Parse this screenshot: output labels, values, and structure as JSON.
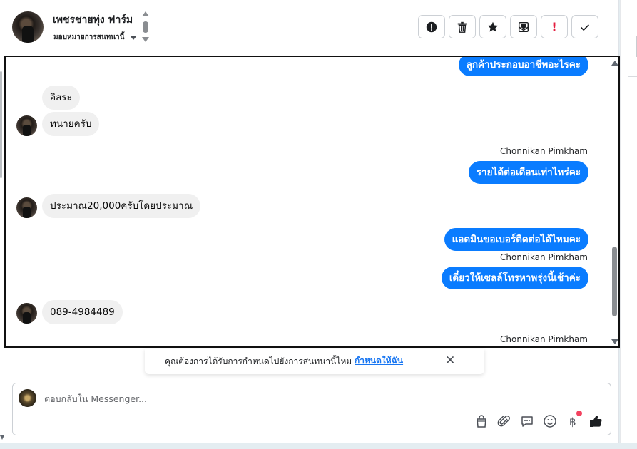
{
  "header": {
    "contact_name": "เพชรชายทุ่ง ฟาร์ม",
    "assign_label": "มอบหมายการสนทนานี้",
    "actions": [
      {
        "name": "mark-spam-button",
        "icon": "exclamation-circle-icon"
      },
      {
        "name": "delete-button",
        "icon": "trash-icon"
      },
      {
        "name": "star-button",
        "icon": "star-icon"
      },
      {
        "name": "mark-unread-button",
        "icon": "envelope-icon"
      },
      {
        "name": "follow-up-button",
        "icon": "exclamation-icon",
        "label": "!"
      },
      {
        "name": "mark-done-button",
        "icon": "check-icon"
      }
    ]
  },
  "messages": [
    {
      "dir": "out",
      "text": "ลูกค้าประกอบอาชีพอะไรคะ"
    },
    {
      "dir": "in",
      "text": "อิสระ",
      "avatar": false
    },
    {
      "dir": "in",
      "text": "ทนายครับ",
      "avatar": true
    },
    {
      "dir": "sender",
      "text": "Chonnikan Pimkham"
    },
    {
      "dir": "out",
      "text": "รายได้ต่อเดือนเท่าไหร่คะ"
    },
    {
      "dir": "in",
      "text": "ประมาณ20,000ครับโดยประมาณ",
      "avatar": true
    },
    {
      "dir": "out",
      "text": "แอดมินขอเบอร์ติดต่อได้ไหมคะ"
    },
    {
      "dir": "sender",
      "text": "Chonnikan Pimkham"
    },
    {
      "dir": "out",
      "text": "เดี๋ยวให้เซลล์โทรหาพรุ่งนี้เช้าค่ะ"
    },
    {
      "dir": "in",
      "text": "089-4984489",
      "avatar": true
    },
    {
      "dir": "sender",
      "text": "Chonnikan Pimkham"
    }
  ],
  "notice": {
    "text": "คุณต้องการได้รับการกำหนดไปยังการสนทนานี้ไหม",
    "link": "กำหนดให้ฉัน",
    "close": "✕"
  },
  "composer": {
    "placeholder": "ตอบกลับใน Messenger..."
  },
  "tools": [
    "shopping-bag-icon",
    "paperclip-icon",
    "saved-reply-icon",
    "emoji-icon",
    "baht-payment-icon",
    "like-icon"
  ],
  "colors": {
    "accent": "#0a7cff",
    "incoming_bubble": "#f0f0f0",
    "link": "#1876f2",
    "badge": "#f3425f"
  }
}
